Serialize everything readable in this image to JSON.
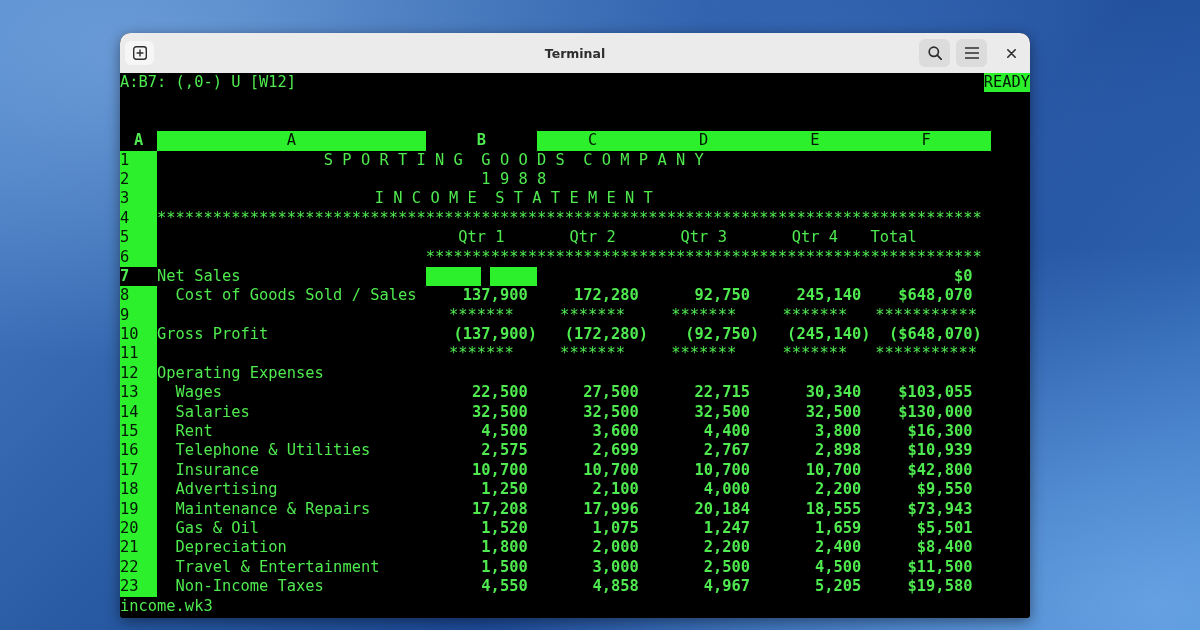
{
  "window": {
    "title": "Terminal"
  },
  "status_line": {
    "cell_info": "A:B7: (,0-) U [W12]",
    "mode": "READY"
  },
  "sheet": {
    "name": "A",
    "columns": [
      {
        "label": "A",
        "selected": false
      },
      {
        "label": "B",
        "selected": true
      },
      {
        "label": "C",
        "selected": false
      },
      {
        "label": "D",
        "selected": false
      },
      {
        "label": "E",
        "selected": false
      },
      {
        "label": "F",
        "selected": false
      }
    ],
    "rows": [
      {
        "number": "1",
        "kind": "title",
        "selected": false,
        "text": "S P O R T I N G  G O O D S  C O M P A N Y"
      },
      {
        "number": "2",
        "kind": "title",
        "selected": false,
        "text": "1 9 8 8"
      },
      {
        "number": "3",
        "kind": "title",
        "selected": false,
        "text": "I N C O M E  S T A T E M E N T"
      },
      {
        "number": "4",
        "kind": "rule",
        "selected": false,
        "label": "*****************************************************************************************"
      },
      {
        "number": "5",
        "kind": "header",
        "selected": false,
        "qtr_1": "Qtr 1",
        "qtr_2": "Qtr 2",
        "qtr_3": "Qtr 3",
        "qtr_4": "Qtr 4",
        "total": "Total"
      },
      {
        "number": "6",
        "kind": "rule",
        "selected": false,
        "qtr_1": "************************************************************"
      },
      {
        "number": "7",
        "kind": "item",
        "selected": true,
        "label": "Net Sales",
        "total": "$0",
        "children": [
          {
            "number": "8",
            "kind": "item",
            "selected": false,
            "label": "Cost of Goods Sold / Sales",
            "qtr_1": "137,900",
            "qtr_2": "172,280",
            "qtr_3": "92,750",
            "qtr_4": "245,140",
            "total": "$648,070"
          }
        ]
      },
      {
        "number": "9",
        "kind": "rule",
        "selected": false,
        "qtr_1": "*******",
        "qtr_2": "*******",
        "qtr_3": "*******",
        "qtr_4": "*******",
        "total": "***********"
      },
      {
        "number": "10",
        "kind": "subtotal",
        "selected": false,
        "label": "Gross Profit",
        "qtr_1": "(137,900)",
        "qtr_2": "(172,280)",
        "qtr_3": "(92,750)",
        "qtr_4": "(245,140)",
        "total": "($648,070)"
      },
      {
        "number": "11",
        "kind": "rule",
        "selected": false,
        "qtr_1": "*******",
        "qtr_2": "*******",
        "qtr_3": "*******",
        "qtr_4": "*******",
        "total": "***********"
      },
      {
        "number": "12",
        "kind": "item",
        "selected": false,
        "label": "Operating Expenses",
        "children": [
          {
            "number": "13",
            "kind": "item",
            "selected": false,
            "label": "Wages",
            "qtr_1": "22,500",
            "qtr_2": "27,500",
            "qtr_3": "22,715",
            "qtr_4": "30,340",
            "total": "$103,055"
          },
          {
            "number": "14",
            "kind": "item",
            "selected": false,
            "label": "Salaries",
            "qtr_1": "32,500",
            "qtr_2": "32,500",
            "qtr_3": "32,500",
            "qtr_4": "32,500",
            "total": "$130,000"
          },
          {
            "number": "15",
            "kind": "item",
            "selected": false,
            "label": "Rent",
            "qtr_1": "4,500",
            "qtr_2": "3,600",
            "qtr_3": "4,400",
            "qtr_4": "3,800",
            "total": "$16,300"
          },
          {
            "number": "16",
            "kind": "item",
            "selected": false,
            "label": "Telephone & Utilities",
            "qtr_1": "2,575",
            "qtr_2": "2,699",
            "qtr_3": "2,767",
            "qtr_4": "2,898",
            "total": "$10,939"
          },
          {
            "number": "17",
            "kind": "item",
            "selected": false,
            "label": "Insurance",
            "qtr_1": "10,700",
            "qtr_2": "10,700",
            "qtr_3": "10,700",
            "qtr_4": "10,700",
            "total": "$42,800"
          },
          {
            "number": "18",
            "kind": "item",
            "selected": false,
            "label": "Advertising",
            "qtr_1": "1,250",
            "qtr_2": "2,100",
            "qtr_3": "4,000",
            "qtr_4": "2,200",
            "total": "$9,550"
          },
          {
            "number": "19",
            "kind": "item",
            "selected": false,
            "label": "Maintenance & Repairs",
            "qtr_1": "17,208",
            "qtr_2": "17,996",
            "qtr_3": "20,184",
            "qtr_4": "18,555",
            "total": "$73,943"
          },
          {
            "number": "20",
            "kind": "item",
            "selected": false,
            "label": "Gas & Oil",
            "qtr_1": "1,520",
            "qtr_2": "1,075",
            "qtr_3": "1,247",
            "qtr_4": "1,659",
            "total": "$5,501"
          },
          {
            "number": "21",
            "kind": "item",
            "selected": false,
            "label": "Depreciation",
            "qtr_1": "1,800",
            "qtr_2": "2,000",
            "qtr_3": "2,200",
            "qtr_4": "2,400",
            "total": "$8,400"
          },
          {
            "number": "22",
            "kind": "item",
            "selected": false,
            "label": "Travel & Entertainment",
            "qtr_1": "1,500",
            "qtr_2": "3,000",
            "qtr_3": "2,500",
            "qtr_4": "4,500",
            "total": "$11,500"
          },
          {
            "number": "23",
            "kind": "item",
            "selected": false,
            "label": "Non-Income Taxes",
            "qtr_1": "4,550",
            "qtr_2": "4,858",
            "qtr_3": "4,967",
            "qtr_4": "5,205",
            "total": "$19,580"
          }
        ]
      }
    ]
  },
  "file_name": "income.wk3"
}
